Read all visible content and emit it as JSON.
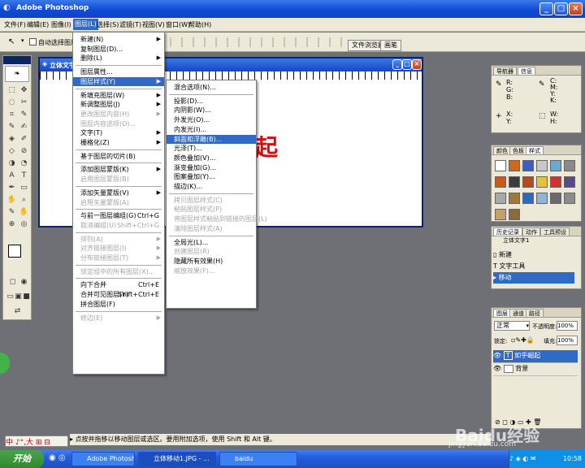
{
  "window": {
    "title": "Adobe Photoshop"
  },
  "menubar": [
    "文件(F)",
    "编辑(E)",
    "图像(I)",
    "图层(L)",
    "选择(S)",
    "滤镜(T)",
    "视图(V)",
    "窗口(W)",
    "帮助(H)"
  ],
  "options": {
    "auto_select": "自动选择图层"
  },
  "browser_tabs": [
    "文件浏览器",
    "画笔"
  ],
  "document": {
    "title": "立体文字1",
    "text_char": "起"
  },
  "layer_menu": [
    {
      "label": "新建(N)",
      "arrow": true
    },
    {
      "label": "复制图层(D)..."
    },
    {
      "label": "删除(L)",
      "arrow": true
    },
    {
      "sep": true
    },
    {
      "label": "图层属性..."
    },
    {
      "label": "图层样式(Y)",
      "arrow": true,
      "hl": true
    },
    {
      "sep": true
    },
    {
      "label": "新填充图层(W)",
      "arrow": true
    },
    {
      "label": "新调整图层(J)",
      "arrow": true
    },
    {
      "label": "更改图层内容(H)",
      "arrow": true,
      "dis": true
    },
    {
      "label": "图层内容选项(O)...",
      "dis": true
    },
    {
      "label": "文字(T)",
      "arrow": true
    },
    {
      "label": "栅格化(Z)",
      "arrow": true
    },
    {
      "sep": true
    },
    {
      "label": "基于图层的切片(B)"
    },
    {
      "sep": true
    },
    {
      "label": "添加图层蒙版(K)",
      "arrow": true
    },
    {
      "label": "启用图层蒙版(B)",
      "dis": true
    },
    {
      "sep": true
    },
    {
      "label": "添加矢量蒙版(V)",
      "arrow": true
    },
    {
      "label": "启用矢量蒙版(A)",
      "dis": true
    },
    {
      "sep": true
    },
    {
      "label": "与前一图层编组(G)",
      "shortcut": "Ctrl+G"
    },
    {
      "label": "取消编组(U)",
      "shortcut": "Shift+Ctrl+G",
      "dis": true
    },
    {
      "sep": true
    },
    {
      "label": "排列(A)",
      "arrow": true,
      "dis": true
    },
    {
      "label": "对齐链接图层(I)",
      "arrow": true,
      "dis": true
    },
    {
      "label": "分布链接图层(T)",
      "arrow": true,
      "dis": true
    },
    {
      "sep": true
    },
    {
      "label": "锁定组中的所有图层(X)...",
      "dis": true
    },
    {
      "sep": true
    },
    {
      "label": "向下合并",
      "shortcut": "Ctrl+E"
    },
    {
      "label": "合并可见图层(Y)",
      "shortcut": "Shift+Ctrl+E"
    },
    {
      "label": "拼合图层(F)"
    },
    {
      "sep": true
    },
    {
      "label": "修边(E)",
      "arrow": true,
      "dis": true
    }
  ],
  "style_menu": [
    {
      "label": "混合选项(N)..."
    },
    {
      "sep": true
    },
    {
      "label": "投影(D)..."
    },
    {
      "label": "内阴影(W)..."
    },
    {
      "label": "外发光(O)..."
    },
    {
      "label": "内发光(I)..."
    },
    {
      "label": "斜面和浮雕(B)...",
      "hl": true
    },
    {
      "label": "光泽(T)..."
    },
    {
      "label": "颜色叠加(V)..."
    },
    {
      "label": "渐变叠加(G)..."
    },
    {
      "label": "图案叠加(Y)..."
    },
    {
      "label": "描边(K)..."
    },
    {
      "sep": true
    },
    {
      "label": "拷贝图层样式(C)",
      "dis": true
    },
    {
      "label": "粘贴图层样式(P)",
      "dis": true
    },
    {
      "label": "将图层样式粘贴到链接的图层(L)",
      "dis": true
    },
    {
      "label": "清除图层样式(A)",
      "dis": true
    },
    {
      "sep": true
    },
    {
      "label": "全局光(L)..."
    },
    {
      "label": "创建图层(R)",
      "dis": true
    },
    {
      "label": "隐藏所有效果(H)"
    },
    {
      "label": "缩放效果(F)...",
      "dis": true
    }
  ],
  "nav_panel": {
    "tabs": [
      "导航器",
      "信息"
    ],
    "labels_left": [
      "R:",
      "G:",
      "B:"
    ],
    "labels_right": [
      "C:",
      "M:",
      "Y:",
      "K:"
    ],
    "xy": [
      "X:",
      "Y:"
    ],
    "wh": [
      "W:",
      "H:"
    ]
  },
  "color_panel": {
    "tabs": [
      "颜色",
      "色板",
      "样式"
    ]
  },
  "history_panel": {
    "tabs": [
      "历史记录",
      "动作",
      "工具预设"
    ],
    "snapshot": "立体文字1",
    "items": [
      "新建",
      "文字工具",
      "移动"
    ]
  },
  "layers_panel": {
    "tabs": [
      "图层",
      "通道",
      "路径"
    ],
    "mode": "正常",
    "opacity_label": "不透明度:",
    "opacity": "100%",
    "lock_label": "锁定:",
    "fill_label": "填充:",
    "fill": "100%",
    "layers": [
      "如乎崛起",
      "背景"
    ],
    "layer_icon": "T"
  },
  "statusbar": "点按并拖移以移动图层或选区。要用附加选项，使用 Shift 和 Alt 键。",
  "ime": "中 ♪°,大 ⊞ ⊟",
  "taskbar": {
    "start": "开始",
    "tasks": [
      "Adobe Photoshop",
      "立体移动1.JPG - ...",
      "baidu"
    ],
    "time": "10:58"
  },
  "watermark": {
    "text": "Baidu经验",
    "url": "jingyan.baidu.com"
  },
  "colors": {
    "titlebar": "#0f4bd8",
    "menu_highlight": "#316ac5",
    "text_red": "#d60d0d",
    "taskbar": "#245edb"
  }
}
